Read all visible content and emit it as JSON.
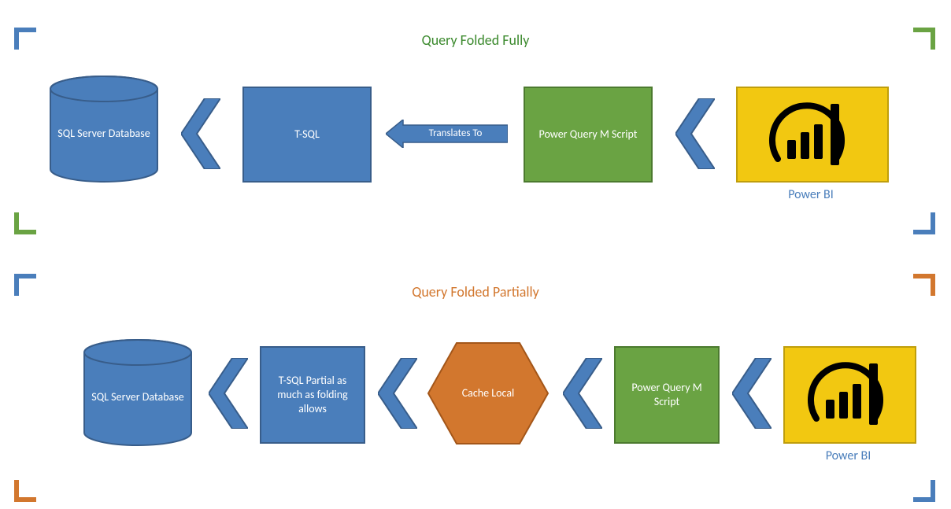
{
  "colors": {
    "blue_fill": "#4a7ebb",
    "blue_stroke": "#385d8a",
    "green_fill": "#6aa343",
    "green_stroke": "#4c7a2f",
    "orange_fill": "#d2772e",
    "orange_stroke": "#a35619",
    "yellow_fill": "#f2c811",
    "yellow_stroke": "#bf9e0c",
    "title_green": "#3c8a2e",
    "title_orange": "#d2772e",
    "label_blue": "#4a7ebb",
    "corner_blue": "#4a7ebb",
    "corner_green": "#6aa343",
    "corner_orange": "#d2772e"
  },
  "section1": {
    "title": "Query Folded Fully",
    "db_label": "SQL Server Database",
    "tsql_label": "T-SQL",
    "translates_label": "Translates To",
    "mscript_label": "Power Query M Script",
    "powerbi_label": "Power BI"
  },
  "section2": {
    "title": "Query Folded Partially",
    "db_label": "SQL Server Database",
    "tsql_label": "T-SQL Partial as much as folding allows",
    "cache_label": "Cache Local",
    "mscript_label": "Power Query M Script",
    "powerbi_label": "Power BI"
  }
}
